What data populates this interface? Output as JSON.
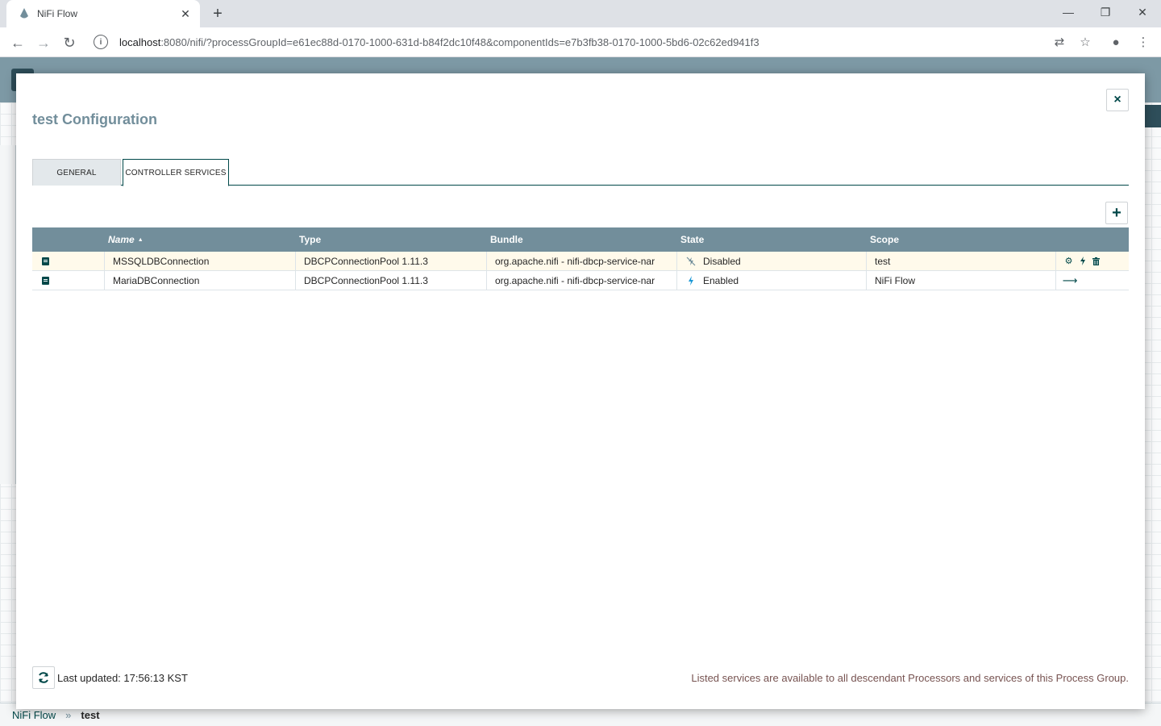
{
  "browser": {
    "tab_title": "NiFi Flow",
    "url_host": "localhost",
    "url_path": ":8080/nifi/?processGroupId=e61ec88d-0170-1000-631d-b84f2dc10f48&componentIds=e7b3fb38-0170-1000-5bd6-02c62ed941f3"
  },
  "dialog": {
    "title": "test Configuration",
    "close_glyph": "×",
    "tabs": [
      {
        "label": "GENERAL"
      },
      {
        "label": "CONTROLLER SERVICES"
      }
    ],
    "add_glyph": "+"
  },
  "table": {
    "columns": [
      "",
      "Name",
      "Type",
      "Bundle",
      "State",
      "Scope",
      ""
    ],
    "sort_arrow": "▲",
    "rows": [
      {
        "name": "MSSQLDBConnection",
        "type": "DBCPConnectionPool 1.11.3",
        "bundle": "org.apache.nifi - nifi-dbcp-service-nar",
        "state": "Disabled",
        "scope": "test",
        "actions": [
          "gear-icon",
          "flash-icon",
          "trash-icon"
        ]
      },
      {
        "name": "MariaDBConnection",
        "type": "DBCPConnectionPool 1.11.3",
        "bundle": "org.apache.nifi - nifi-dbcp-service-nar",
        "state": "Enabled",
        "scope": "NiFi Flow",
        "actions": [
          "arrow-right-icon"
        ]
      }
    ]
  },
  "footer": {
    "updated_label": "Last updated:",
    "updated_time": "17:56:13 KST",
    "note": "Listed services are available to all descendant Processors and services of this Process Group."
  },
  "breadcrumb": {
    "root": "NiFi Flow",
    "separator": "»",
    "current": "test"
  },
  "colors": {
    "header": "#728e9b",
    "accent": "#004849",
    "selected_row": "#fffaeb",
    "enabled": "#1b98d6"
  }
}
